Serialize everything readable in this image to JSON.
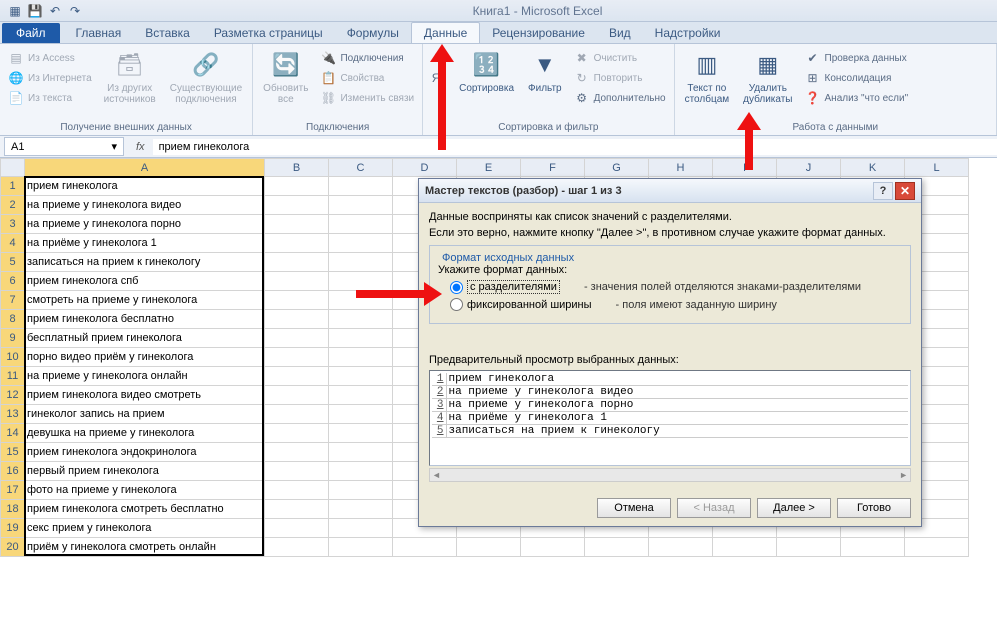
{
  "app_title": "Книга1 - Microsoft Excel",
  "tabs": {
    "file": "Файл",
    "items": [
      "Главная",
      "Вставка",
      "Разметка страницы",
      "Формулы",
      "Данные",
      "Рецензирование",
      "Вид",
      "Надстройки"
    ],
    "active": "Данные"
  },
  "ribbon": {
    "g1": {
      "label": "Получение внешних данных",
      "access": "Из Access",
      "web": "Из Интернета",
      "text": "Из текста",
      "other": "Из других\nисточников",
      "existing": "Существующие\nподключения"
    },
    "g2": {
      "label": "Подключения",
      "refresh": "Обновить\nвсе",
      "conns": "Подключения",
      "props": "Свойства",
      "links": "Изменить связи"
    },
    "g3": {
      "label": "Сортировка и фильтр",
      "sort": "Сортировка",
      "filter": "Фильтр",
      "clear": "Очистить",
      "reapply": "Повторить",
      "adv": "Дополнительно"
    },
    "g4": {
      "label": "Работа с данными",
      "ttc": "Текст по\nстолбцам",
      "dup": "Удалить\nдубликаты",
      "valid": "Проверка данных",
      "consol": "Консолидация",
      "whatif": "Анализ \"что если\""
    }
  },
  "formula_bar": {
    "name": "A1",
    "value": "прием гинеколога"
  },
  "columns": [
    "A",
    "B",
    "C",
    "D",
    "E",
    "F",
    "G",
    "H",
    "I",
    "J",
    "K",
    "L"
  ],
  "rows": [
    "прием гинеколога",
    "на приеме у гинеколога видео",
    "на приеме у гинеколога порно",
    "на приёме у гинеколога 1",
    "записаться на прием к гинекологу",
    "прием гинеколога спб",
    "смотреть на приеме у гинеколога",
    "прием гинеколога бесплатно",
    "бесплатный прием гинеколога",
    "порно видео приём у гинеколога",
    "на приеме у гинеколога онлайн",
    "прием гинеколога видео смотреть",
    "гинеколог запись на прием",
    "девушка на приеме у гинеколога",
    "прием гинеколога эндокринолога",
    "первый прием гинеколога",
    "фото на приеме у гинеколога",
    "прием гинеколога смотреть бесплатно",
    "секс прием у гинеколога",
    "приём у гинеколога смотреть онлайн"
  ],
  "dialog": {
    "title": "Мастер текстов (разбор) - шаг 1 из 3",
    "line1": "Данные восприняты как список значений с разделителями.",
    "line2": "Если это верно, нажмите кнопку \"Далее >\", в противном случае укажите формат данных.",
    "legend": "Формат исходных данных",
    "prompt": "Укажите формат данных:",
    "opt1": "с разделителями",
    "opt1_desc": "- значения полей отделяются знаками-разделителями",
    "opt2": "фиксированной ширины",
    "opt2_desc": "- поля имеют заданную ширину",
    "preview_label": "Предварительный просмотр выбранных данных:",
    "preview": [
      "прием гинеколога",
      "на приеме у гинеколога видео",
      "на приеме у гинеколога порно",
      "на приёме у гинеколога 1",
      "записаться на прием к гинекологу"
    ],
    "btn_cancel": "Отмена",
    "btn_back": "< Назад",
    "btn_next": "Далее >",
    "btn_finish": "Готово"
  }
}
